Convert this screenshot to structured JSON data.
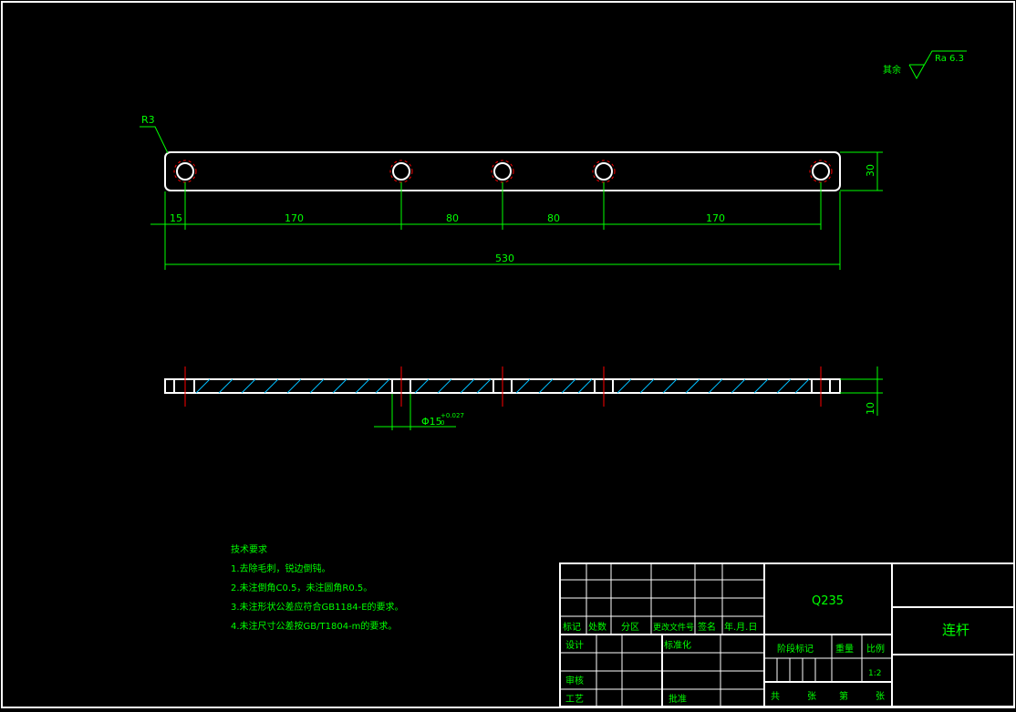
{
  "colors": {
    "background": "#000000",
    "outline": "#ffffff",
    "dimension": "#00ff00",
    "centerline": "#ff0000",
    "hatch": "#00bfff",
    "text": "#00ff00"
  },
  "roughness": {
    "prefix": "其余",
    "value": "Ra 6.3"
  },
  "fillet_label": "R3",
  "dimensions": {
    "hole_spacing": [
      "15",
      "170",
      "80",
      "80",
      "170"
    ],
    "overall_length": "530",
    "width": "30",
    "thickness": "10",
    "hole_dia": "Φ15",
    "hole_tol_upper": "+0.027",
    "hole_tol_lower": "0"
  },
  "tech_requirements": {
    "title": "技术要求",
    "items": [
      "1.去除毛刺，锐边倒钝。",
      "2.未注倒角C0.5，未注圆角R0.5。",
      "3.未注形状公差应符合GB1184-E的要求。",
      "4.未注尺寸公差按GB/T1804-m的要求。"
    ]
  },
  "title_block": {
    "material": "Q235",
    "part_name": "连杆",
    "header": [
      "标记",
      "处数",
      "分区",
      "更改文件号",
      "签名",
      "年.月.日"
    ],
    "design": "设计",
    "standardize": "标准化",
    "review": "审核",
    "process": "工艺",
    "approve": "批准",
    "stage_mark": "阶段标记",
    "weight": "重量",
    "scale": "比例",
    "scale_value": "1:2",
    "sheets_total": "共",
    "sheet_unit": "张",
    "sheet_no": "第",
    "sheet_unit2": "张"
  }
}
